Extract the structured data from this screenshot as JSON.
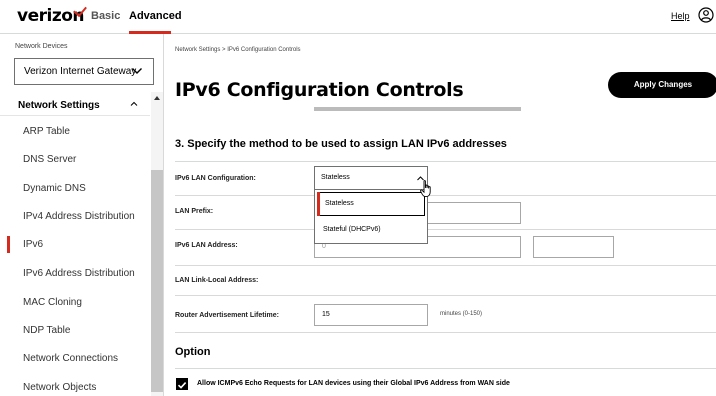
{
  "topbar": {
    "logo_text": "verizon",
    "tab_basic": "Basic",
    "tab_advanced": "Advanced",
    "help_label": "Help",
    "icons": [
      "verizon-check-icon",
      "user-icon"
    ],
    "accent_color": "#d52b1e"
  },
  "sidebar": {
    "devices_label": "Network Devices",
    "device_selected": "Verizon Internet Gateway",
    "section_title": "Network Settings",
    "items": [
      {
        "label": "ARP Table"
      },
      {
        "label": "DNS Server"
      },
      {
        "label": "Dynamic DNS"
      },
      {
        "label": "IPv4 Address Distribution"
      },
      {
        "label": "IPv6"
      },
      {
        "label": "IPv6 Address Distribution"
      },
      {
        "label": "MAC Cloning"
      },
      {
        "label": "NDP Table"
      },
      {
        "label": "Network Connections"
      },
      {
        "label": "Network Objects"
      }
    ],
    "active_item": "IPv6"
  },
  "main": {
    "breadcrumb": "Network Settings  >  IPv6 Configuration Controls",
    "page_title": "IPv6 Configuration Controls",
    "apply_button": "Apply Changes",
    "section_heading": "3. Specify the method to be used to assign LAN IPv6 addresses",
    "rows": {
      "lan_config_label": "IPv6 LAN Configuration:",
      "lan_prefix_label": "LAN Prefix:",
      "lan_address_label": "IPv6 LAN Address:",
      "lan_address_value": "0",
      "link_local_label": "LAN Link-Local Address:",
      "router_adv_label": "Router Advertisement Lifetime:",
      "router_adv_value": "15",
      "router_adv_units": "minutes (0-150)"
    },
    "dropdown": {
      "selected": "Stateless",
      "options": [
        "Stateless",
        "Stateful (DHCPv6)"
      ]
    },
    "option_heading": "Option",
    "checkbox_label": "Allow ICMPv6 Echo Requests for LAN devices using their Global IPv6 Address from WAN side",
    "checkbox_checked": true
  }
}
